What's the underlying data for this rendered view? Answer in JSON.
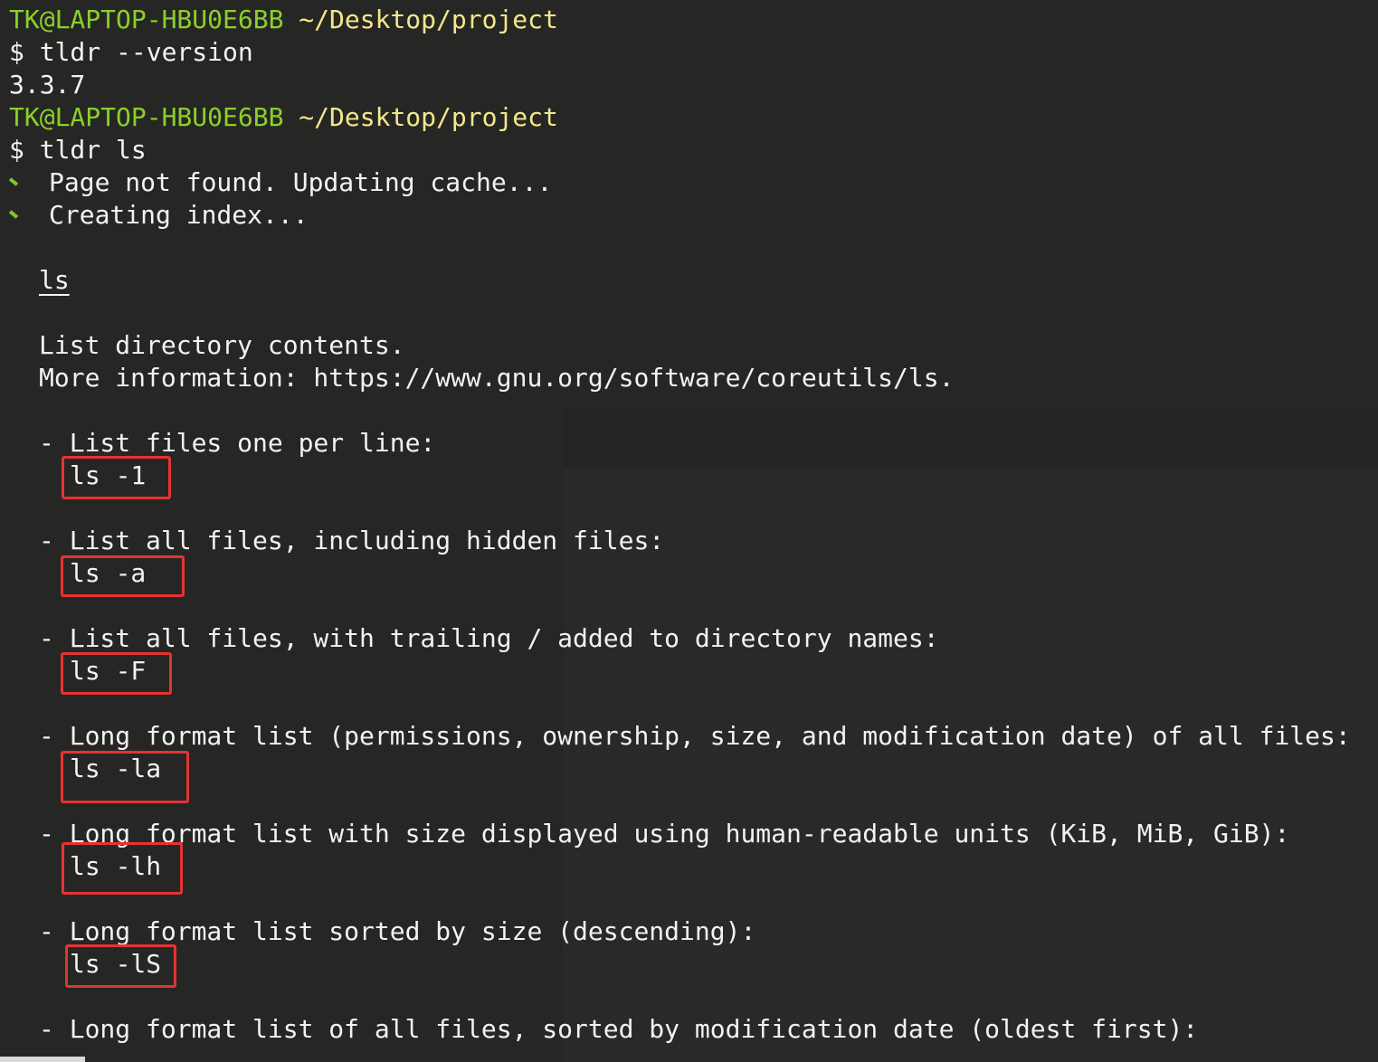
{
  "prompt": {
    "user": "TK@LAPTOP-HBU0E6BB",
    "path": "~/Desktop/project"
  },
  "session": {
    "cmd1": "$ tldr --version",
    "out1": "3.3.7",
    "cmd2": "$ tldr ls",
    "status1": "Page not found. Updating cache...",
    "status2": "Creating index..."
  },
  "page": {
    "title": "ls",
    "desc1": "List directory contents.",
    "desc2": "More information: https://www.gnu.org/software/coreutils/ls."
  },
  "examples": [
    {
      "desc": "- List files one per line:",
      "cmd": "ls -1"
    },
    {
      "desc": "- List all files, including hidden files:",
      "cmd": "ls -a"
    },
    {
      "desc": "- List all files, with trailing / added to directory names:",
      "cmd": "ls -F"
    },
    {
      "desc": "- Long format list (permissions, ownership, size, and modification date) of all files:",
      "cmd": "ls -la"
    },
    {
      "desc": "- Long format list with size displayed using human-readable units (KiB, MiB, GiB):",
      "cmd": "ls -lh"
    },
    {
      "desc": "- Long format list sorted by size (descending):",
      "cmd": "ls -lS"
    },
    {
      "desc": "- Long format list of all files, sorted by modification date (oldest first):",
      "cmd": ""
    }
  ],
  "colors": {
    "background": "#262725",
    "prompt_user": "#8ccf2a",
    "prompt_path": "#f4e78a",
    "highlight_box": "#e53333",
    "spinner": "#7cc63a"
  }
}
